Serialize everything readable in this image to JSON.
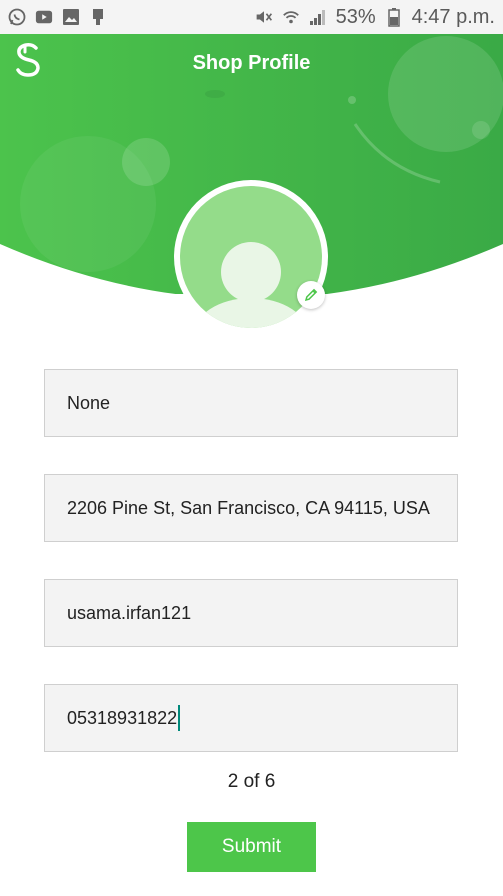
{
  "status_bar": {
    "left_icons": [
      "whatsapp-icon",
      "youtube-icon",
      "gallery-icon",
      "usb-icon"
    ],
    "right_icons": [
      "mute-icon",
      "wifi-icon",
      "signal-icon",
      "battery-icon"
    ],
    "battery": "53%",
    "time": "4:47 p.m."
  },
  "header": {
    "title": "Shop Profile",
    "colors": {
      "green_dark": "#34a84a",
      "green_light": "#4cc34c",
      "accent": "#4dc64a"
    }
  },
  "form": {
    "fields": [
      {
        "name": "shop-name-field",
        "value": "None"
      },
      {
        "name": "address-field",
        "value": "2206 Pine St, San Francisco, CA 94115, USA"
      },
      {
        "name": "username-field",
        "value": "usama.irfan121"
      },
      {
        "name": "phone-field",
        "value": "05318931822"
      }
    ],
    "pager": "2 of 6",
    "submit_label": "Submit"
  }
}
